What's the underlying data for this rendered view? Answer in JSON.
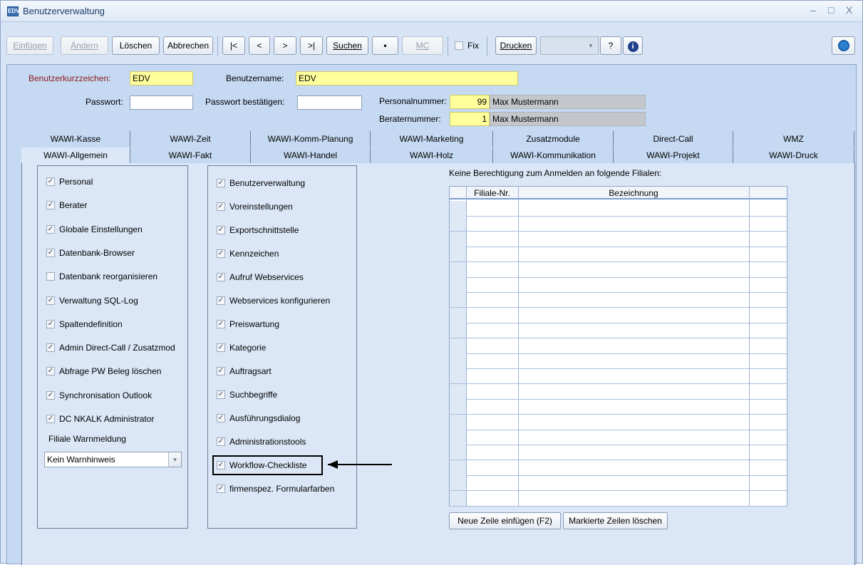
{
  "window": {
    "title": "Benutzerverwaltung",
    "app_icon_text": "EDV",
    "controls": [
      "–",
      "□",
      "X"
    ]
  },
  "toolbar": {
    "einfuegen": "Einfügen",
    "aendern": "Ändern",
    "loeschen": "Löschen",
    "abbrechen": "Abbrechen",
    "first": "|<",
    "prev": "<",
    "next": ">",
    "last": ">|",
    "suchen": "Suchen",
    "dot": "•",
    "mc": "MC",
    "fix_label": "Fix",
    "fix_checked": false,
    "drucken": "Drucken",
    "drucken_select_value": "",
    "help": "?",
    "info": "i"
  },
  "form": {
    "benutzerkurzzeichen_label": "Benutzerkurzzeichen:",
    "benutzerkurzzeichen_value": "EDV",
    "benutzername_label": "Benutzername:",
    "benutzername_value": "EDV",
    "passwort_label": "Passwort:",
    "passwort_value": "",
    "passwort_bestaetigen_label": "Passwort bestätigen:",
    "passwort_bestaetigen_value": "",
    "personalnummer_label": "Personalnummer:",
    "personalnummer_value": "99",
    "personalnummer_name": "Max Mustermann",
    "beraternummer_label": "Beraternummer:",
    "beraternummer_value": "1",
    "beraternummer_name": "Max Mustermann"
  },
  "tabs_row1": [
    "WAWI-Kasse",
    "WAWI-Zeit",
    "WAWI-Komm-Planung",
    "WAWI-Marketing",
    "Zusatzmodule",
    "Direct-Call",
    "WMZ"
  ],
  "tabs_row2": [
    "WAWI-Allgemein",
    "WAWI-Fakt",
    "WAWI-Handel",
    "WAWI-Holz",
    "WAWI-Kommunikation",
    "WAWI-Projekt",
    "WAWI-Druck"
  ],
  "active_tab": "WAWI-Allgemein",
  "left_checkboxes": [
    {
      "label": "Personal",
      "checked": true
    },
    {
      "label": "Berater",
      "checked": true
    },
    {
      "label": "Globale Einstellungen",
      "checked": true
    },
    {
      "label": "Datenbank-Browser",
      "checked": true
    },
    {
      "label": "Datenbank reorganisieren",
      "checked": false
    },
    {
      "label": "Verwaltung SQL-Log",
      "checked": true
    },
    {
      "label": "Spaltendefinition",
      "checked": true
    },
    {
      "label": "Admin Direct-Call / Zusatzmod",
      "checked": true
    },
    {
      "label": "Abfrage PW Beleg löschen",
      "checked": true
    },
    {
      "label": "Synchronisation Outlook",
      "checked": true
    },
    {
      "label": "DC NKALK Administrator",
      "checked": true
    }
  ],
  "filiale_warnmeldung": {
    "label": "Filiale Warnmeldung",
    "value": "Kein Warnhinweis"
  },
  "middle_checkboxes": [
    {
      "label": "Benutzerverwaltung",
      "checked": true
    },
    {
      "label": "Voreinstellungen",
      "checked": true
    },
    {
      "label": "Exportschnittstelle",
      "checked": true
    },
    {
      "label": "Kennzeichen",
      "checked": true
    },
    {
      "label": "Aufruf Webservices",
      "checked": true
    },
    {
      "label": "Webservices konfigurieren",
      "checked": true
    },
    {
      "label": "Preiswartung",
      "checked": true
    },
    {
      "label": "Kategorie",
      "checked": true
    },
    {
      "label": "Auftragsart",
      "checked": true
    },
    {
      "label": "Suchbegriffe",
      "checked": true
    },
    {
      "label": "Ausführungsdialog",
      "checked": true
    },
    {
      "label": "Administrationstools",
      "checked": true
    },
    {
      "label": "Workflow-Checkliste",
      "checked": true
    },
    {
      "label": "firmenspez. Formularfarben",
      "checked": true
    }
  ],
  "filialen": {
    "caption": "Keine Berechtigung zum Anmelden an folgende Filialen:",
    "columns": [
      "Filiale-Nr.",
      "Bezeichnung"
    ],
    "rows": []
  },
  "buttons": {
    "neue_zeile": "Neue Zeile einfügen (F2)",
    "markierte_loeschen": "Markierte Zeilen löschen"
  }
}
